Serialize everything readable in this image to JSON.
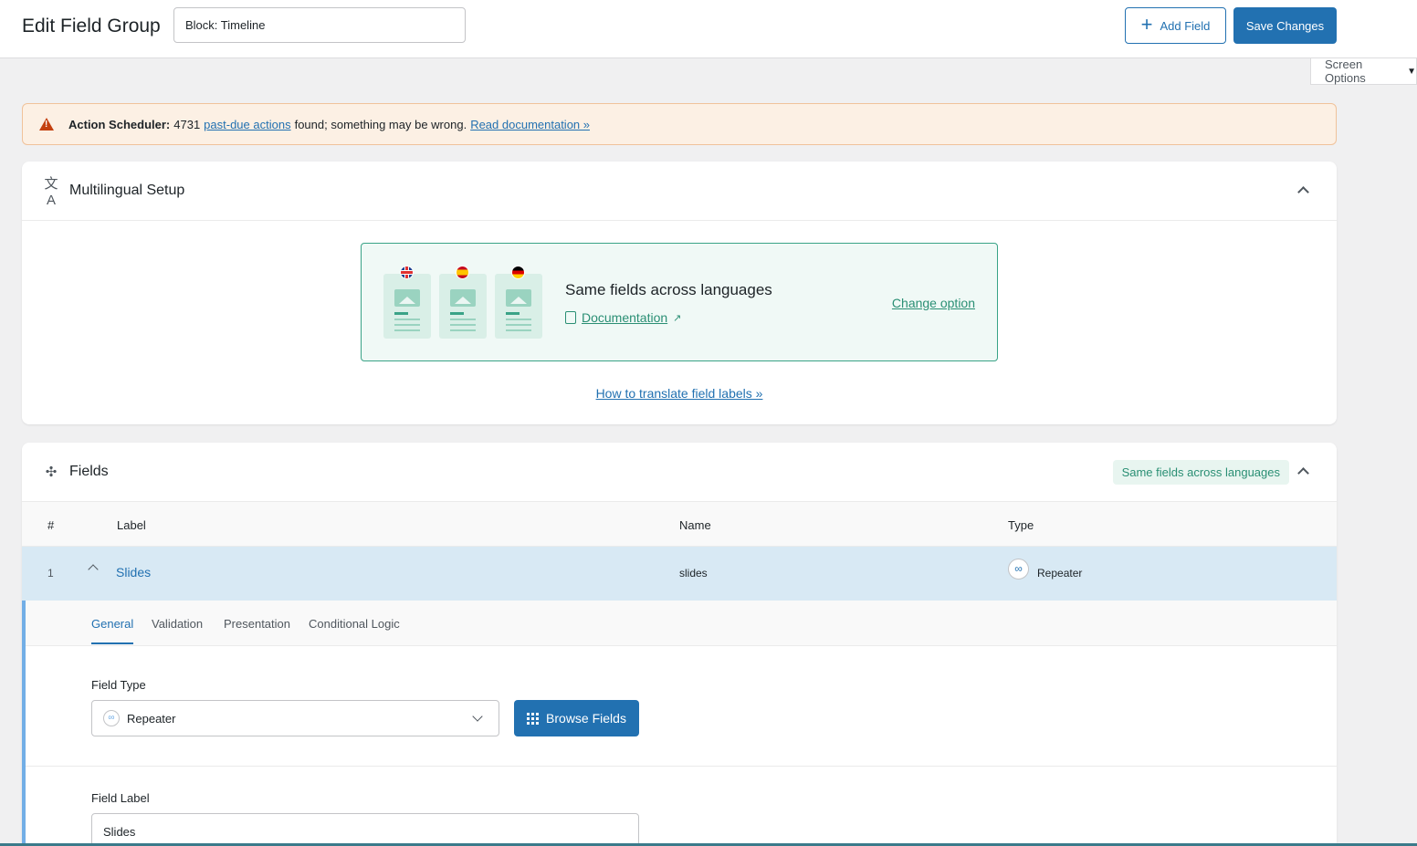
{
  "header": {
    "title": "Edit Field Group",
    "group_title": "Block: Timeline",
    "add_field_label": "Add Field",
    "save_label": "Save Changes"
  },
  "screen_options": {
    "label": "Screen Options"
  },
  "notice": {
    "prefix": "Action Scheduler:",
    "count": "4731",
    "link_text": "past-due actions",
    "message": "found; something may be wrong.",
    "doc_link": "Read documentation »"
  },
  "multilingual": {
    "title": "Multilingual Setup",
    "option_title": "Same fields across languages",
    "documentation": "Documentation",
    "change_option": "Change option",
    "how_to": "How to translate field labels »",
    "flags": [
      "uk-flag-icon",
      "spain-flag-icon",
      "germany-flag-icon"
    ]
  },
  "fields": {
    "title": "Fields",
    "badge": "Same fields across languages",
    "columns": {
      "num": "#",
      "label": "Label",
      "name": "Name",
      "type": "Type"
    },
    "rows": [
      {
        "num": "1",
        "label": "Slides",
        "name": "slides",
        "type": "Repeater",
        "type_icon": "∞"
      }
    ],
    "tabs": [
      "General",
      "Validation",
      "Presentation",
      "Conditional Logic"
    ],
    "field_type_label": "Field Type",
    "field_type_value": "Repeater",
    "browse_label": "Browse Fields",
    "field_label_label": "Field Label",
    "field_label_value": "Slides"
  },
  "colors": {
    "primary": "#2271b1",
    "green": "#2a8f74",
    "notice_bg": "#fcf0e4",
    "row_highlight": "#d8e9f4"
  }
}
